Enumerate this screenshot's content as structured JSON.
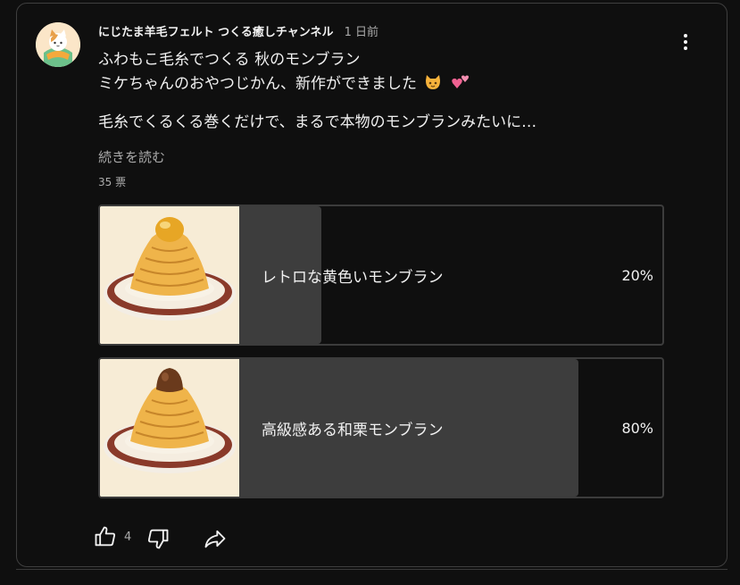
{
  "post": {
    "channel_name": "にじたま羊毛フェルト つくる癒しチャンネル",
    "time_ago": "1 日前",
    "lines": [
      "ふわもこ毛糸でつくる 秋のモンブラン",
      "ミケちゃんのおやつじかん、新作ができました",
      "毛糸でくるくる巻くだけで、まるで本物のモンブランみたいに…"
    ],
    "emojis": [
      "cat-face-icon",
      "two-hearts-icon"
    ],
    "read_more": "続きを読む",
    "votes": "35 票"
  },
  "poll": {
    "options": [
      {
        "label": "レトロな黄色いモンブラン",
        "percent": "20%",
        "fraction": 0.2,
        "image": "yellow-montblanc-image"
      },
      {
        "label": "高級感ある和栗モンブラン",
        "percent": "80%",
        "fraction": 0.8,
        "image": "chestnut-montblanc-image"
      }
    ]
  },
  "actions": {
    "like_count": "4",
    "icons": [
      "thumbs-up-icon",
      "thumbs-down-icon",
      "share-icon"
    ]
  },
  "colors": {
    "background": "#0f0f0f",
    "border": "#3f3f3f",
    "fill": "#3d3d3d",
    "text": "#f1f1f1",
    "secondary_text": "#aaaaaa"
  }
}
